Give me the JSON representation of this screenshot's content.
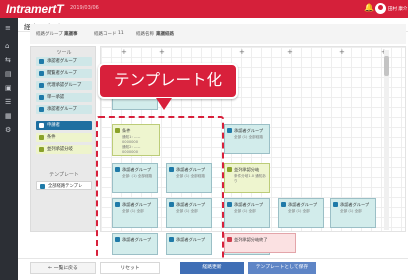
{
  "topbar": {
    "brand": "IntramertT",
    "version": "2019/03/06",
    "user": "田村 康介"
  },
  "header": {
    "title": "経路エディタ"
  },
  "info": {
    "group_label": "経路グループ",
    "group_value": "稟議事",
    "code_label": "経路コード",
    "code_value": "11",
    "name_label": "経路名称",
    "name_value": "稟議経路"
  },
  "tools": {
    "section1": "ツール",
    "items": [
      "承認者グループ",
      "閲覧者グループ",
      "代理承認グループ",
      "単一承認",
      "承認者グループ",
      "申請者",
      "条件",
      "並列承認分岐"
    ],
    "section2": "テンプレート",
    "templates": [
      "全部経路テンプレ"
    ]
  },
  "canvas": {
    "nodes": [
      {
        "title": "申請 課長",
        "line1": "",
        "line2": ""
      },
      {
        "title": "条件",
        "line1": "通知1: ----- 0000000",
        "line2": "通知2: ----- 0000000"
      },
      {
        "title": "承認者グループ",
        "line1": "全部: (1) 全部経路",
        "line2": ""
      },
      {
        "title": "承認者グループ",
        "line1": "全部 (1) 全部経路",
        "line2": ""
      },
      {
        "title": "承認者グループ",
        "line1": "全部 (1) 全部経路",
        "line2": ""
      },
      {
        "title": "並列承認分岐",
        "line1": "条件分岐1.0 通知あり",
        "line2": ""
      },
      {
        "title": "承認者グループ",
        "line1": "全部 (1) 全部",
        "line2": ""
      },
      {
        "title": "承認者グループ",
        "line1": "全部 (1) 全部",
        "line2": ""
      },
      {
        "title": "承認者グループ",
        "line1": "全部 (1) 全部",
        "line2": ""
      },
      {
        "title": "承認者グループ",
        "line1": "全部 (1) 全部",
        "line2": ""
      },
      {
        "title": "承認者グループ",
        "line1": "全部 (1) 全部",
        "line2": ""
      },
      {
        "title": "承認者グループ",
        "line1": "全部 (1) 全部",
        "line2": ""
      },
      {
        "title": "承認者グループ",
        "line1": "全部 (1) 全部",
        "line2": ""
      },
      {
        "title": "承認者グループ",
        "line1": "全部 (1) 全部",
        "line2": ""
      },
      {
        "title": "並列承認分岐終了",
        "line1": "",
        "line2": ""
      }
    ]
  },
  "callout": {
    "text": "テンプレート化"
  },
  "footer": {
    "back": "← 一覧に戻る",
    "reset": "リセット",
    "save": "経路更新",
    "template": "テンプレートとして保存"
  }
}
